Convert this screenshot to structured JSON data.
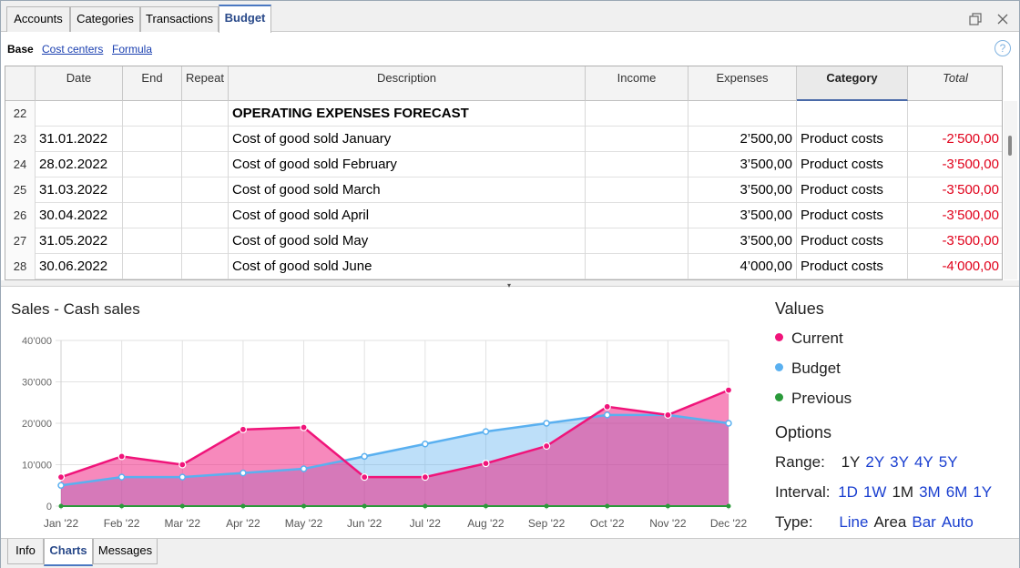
{
  "tabs": [
    "Accounts",
    "Categories",
    "Transactions",
    "Budget"
  ],
  "subnav": {
    "base": "Base",
    "cost_centers": "Cost centers",
    "formula": "Formula",
    "help": "?"
  },
  "table": {
    "columns": [
      "Date",
      "End",
      "Repeat",
      "Description",
      "Income",
      "Expenses",
      "Category",
      "Total"
    ],
    "rows": [
      {
        "n": "22",
        "date": "",
        "desc": "OPERATING EXPENSES FORECAST",
        "exp": "",
        "cat": "",
        "total": ""
      },
      {
        "n": "23",
        "date": "31.01.2022",
        "desc": "Cost of good sold January",
        "exp": "2’500,00",
        "cat": "Product costs",
        "total": "-2’500,00"
      },
      {
        "n": "24",
        "date": "28.02.2022",
        "desc": "Cost of good sold February",
        "exp": "3’500,00",
        "cat": "Product costs",
        "total": "-3’500,00"
      },
      {
        "n": "25",
        "date": "31.03.2022",
        "desc": "Cost of good sold March",
        "exp": "3’500,00",
        "cat": "Product costs",
        "total": "-3’500,00"
      },
      {
        "n": "26",
        "date": "30.04.2022",
        "desc": "Cost of good sold April",
        "exp": "3’500,00",
        "cat": "Product costs",
        "total": "-3’500,00"
      },
      {
        "n": "27",
        "date": "31.05.2022",
        "desc": "Cost of good sold May",
        "exp": "3’500,00",
        "cat": "Product costs",
        "total": "-3’500,00"
      },
      {
        "n": "28",
        "date": "30.06.2022",
        "desc": "Cost of good sold June",
        "exp": "4’000,00",
        "cat": "Product costs",
        "total": "-4’000,00"
      }
    ]
  },
  "chart_title": "Sales - Cash sales",
  "chart_data": {
    "type": "area",
    "categories": [
      "Jan '22",
      "Feb '22",
      "Mar '22",
      "Apr '22",
      "May '22",
      "Jun '22",
      "Jul '22",
      "Aug '22",
      "Sep '22",
      "Oct '22",
      "Nov '22",
      "Dec '22"
    ],
    "ylim": [
      0,
      40000
    ],
    "yticks": [
      "0",
      "10’000",
      "20’000",
      "30’000",
      "40’000"
    ],
    "series": [
      {
        "name": "Budget",
        "color": "#5ab0f0",
        "values": [
          5000,
          7000,
          7000,
          8000,
          9000,
          12000,
          15000,
          18000,
          20000,
          22000,
          22000,
          20000
        ]
      },
      {
        "name": "Current",
        "color": "#f0147a",
        "values": [
          7000,
          12000,
          10000,
          18500,
          19000,
          7000,
          7000,
          10300,
          14500,
          24000,
          22000,
          28000
        ]
      },
      {
        "name": "Previous",
        "color": "#2a9a3a",
        "values": [
          0,
          0,
          0,
          0,
          0,
          0,
          0,
          0,
          0,
          0,
          0,
          0
        ]
      }
    ],
    "grid": true
  },
  "side": {
    "values_title": "Values",
    "legend": [
      {
        "label": "Current",
        "color": "#f0147a"
      },
      {
        "label": "Budget",
        "color": "#5ab0f0"
      },
      {
        "label": "Previous",
        "color": "#2a9a3a"
      }
    ],
    "options_title": "Options",
    "range_label": "Range:",
    "range": [
      "1Y",
      "2Y",
      "3Y",
      "4Y",
      "5Y"
    ],
    "interval_label": "Interval:",
    "interval": [
      "1D",
      "1W",
      "1M",
      "3M",
      "6M",
      "1Y"
    ],
    "type_label": "Type:",
    "types": [
      "Line",
      "Area",
      "Bar",
      "Auto"
    ]
  },
  "bottom_tabs": [
    "Info",
    "Charts",
    "Messages"
  ]
}
